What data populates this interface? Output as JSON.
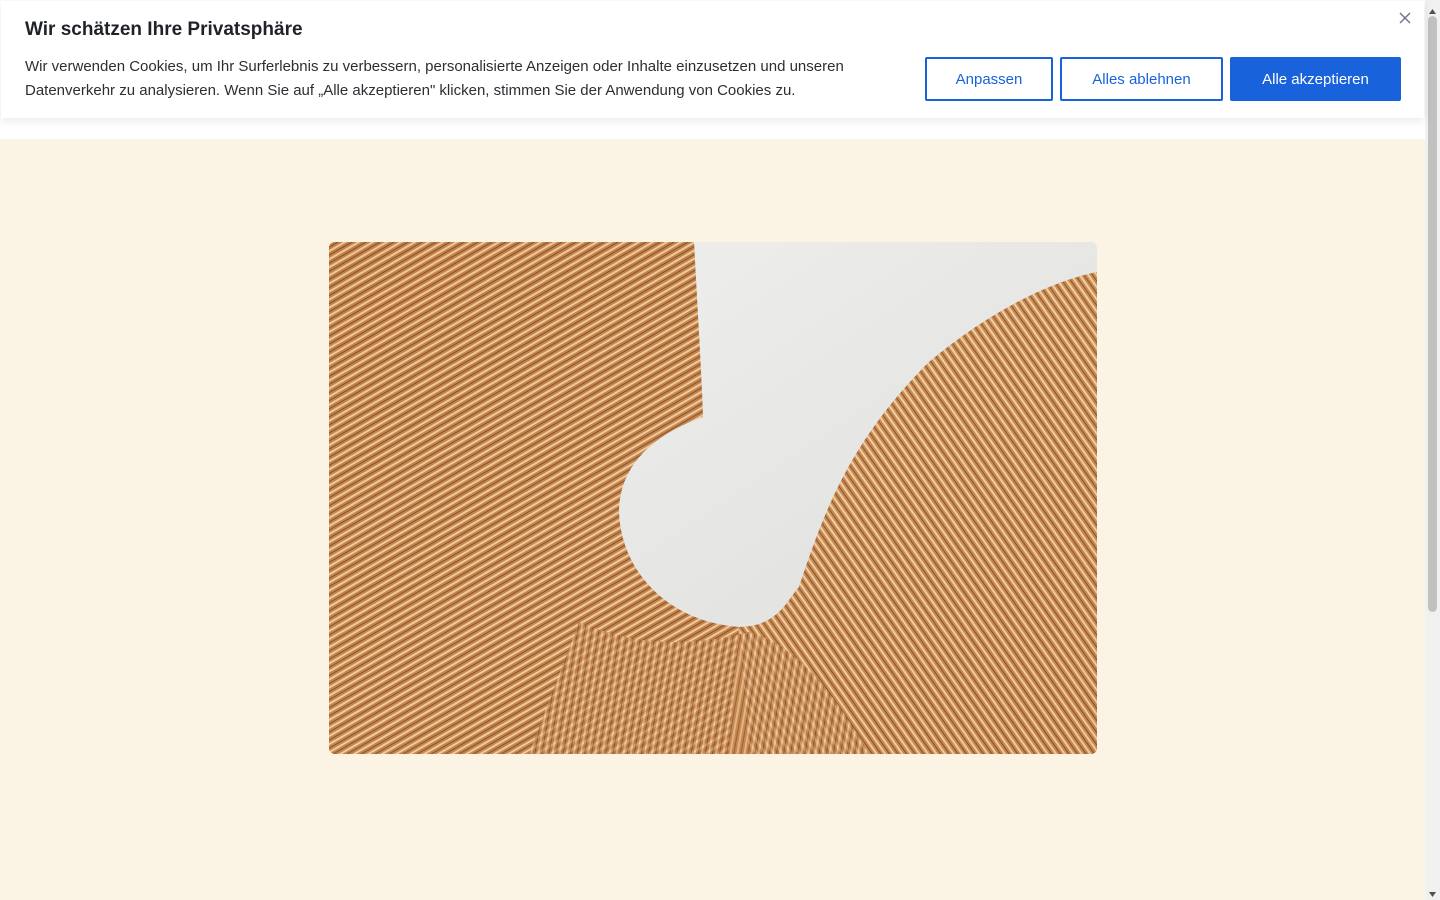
{
  "cookie_banner": {
    "title": "Wir schätzen Ihre Privatsphäre",
    "text": "Wir verwenden Cookies, um Ihr Surferlebnis zu verbessern, personalisierte Anzeigen oder Inhalte einzusetzen und unseren Datenverkehr zu analysieren. Wenn Sie auf „Alle akzeptieren\" klicken, stimmen Sie der Anwendung von Cookies zu.",
    "customize_label": "Anpassen",
    "reject_label": "Alles ablehnen",
    "accept_label": "Alle akzeptieren",
    "close_icon": "close-icon"
  },
  "colors": {
    "accent": "#1863dc",
    "page_background": "#fbf4e4",
    "banner_background": "#ffffff"
  },
  "hero_image": {
    "subject": "wood-sculpture-photo"
  }
}
